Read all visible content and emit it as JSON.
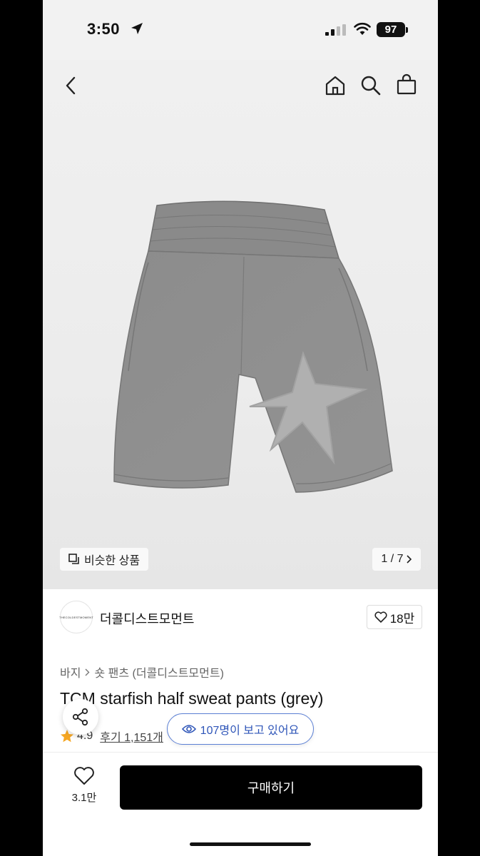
{
  "status_bar": {
    "time": "3:50",
    "battery": "97"
  },
  "gallery": {
    "similar_label": "비슷한 상품",
    "pager": "1 / 7"
  },
  "brand": {
    "name": "더콜디스트모먼트",
    "logo_text": "THECOLDESTMOMENT",
    "likes": "18만"
  },
  "breadcrumb": {
    "level1": "바지",
    "level2": "숏 팬츠 (더콜디스트모먼트)"
  },
  "product": {
    "title": "TCM starfish half sweat pants (grey)",
    "rating": "4.9",
    "reviews": "후기 1,151개"
  },
  "viewers": "107명이 보고 있어요",
  "bottom": {
    "wishlist_count": "3.1만",
    "buy_label": "구매하기"
  },
  "colors": {
    "accent_blue": "#2e55b8",
    "star": "#f5a623",
    "shorts_grey": "#8f8f8f"
  }
}
